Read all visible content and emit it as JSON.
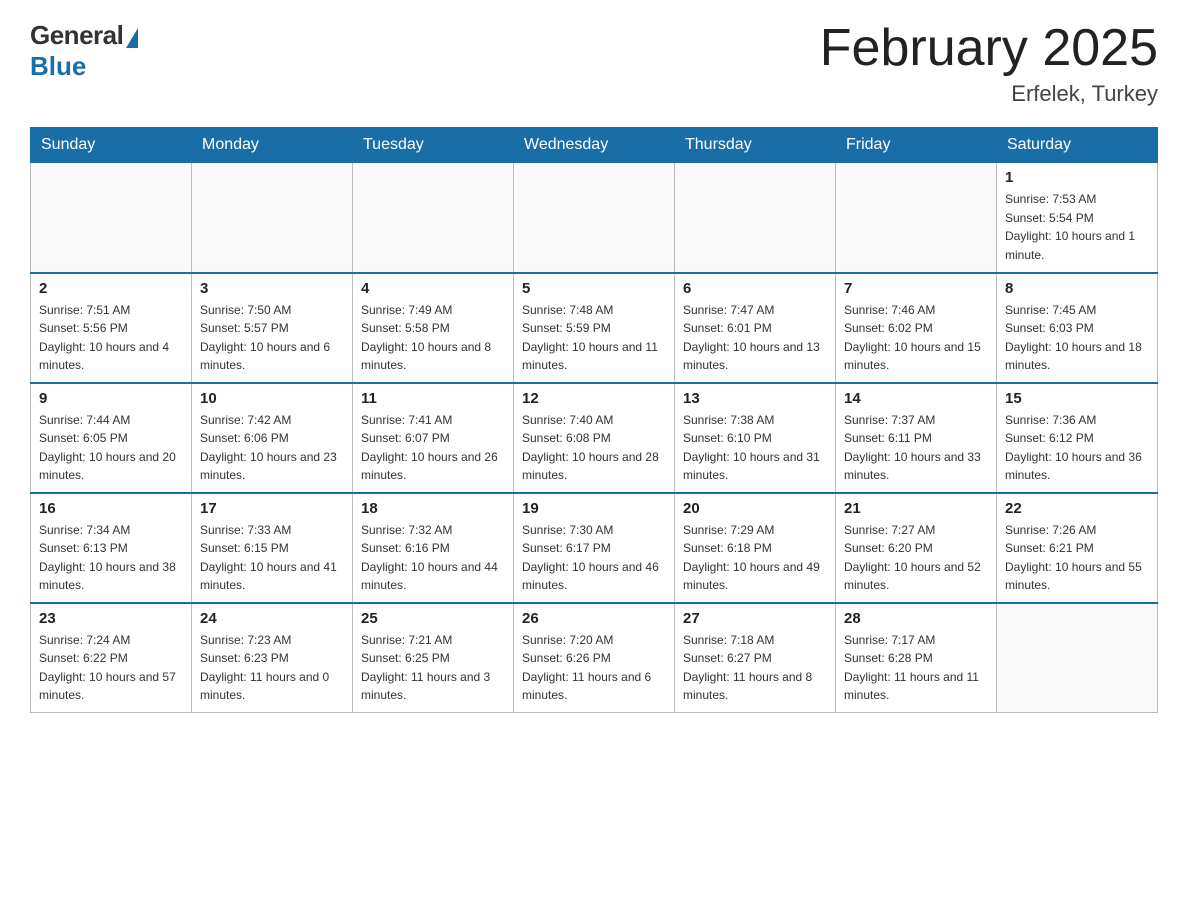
{
  "header": {
    "logo_general": "General",
    "logo_blue": "Blue",
    "month_title": "February 2025",
    "location": "Erfelek, Turkey"
  },
  "weekdays": [
    "Sunday",
    "Monday",
    "Tuesday",
    "Wednesday",
    "Thursday",
    "Friday",
    "Saturday"
  ],
  "weeks": [
    [
      {
        "day": "",
        "info": ""
      },
      {
        "day": "",
        "info": ""
      },
      {
        "day": "",
        "info": ""
      },
      {
        "day": "",
        "info": ""
      },
      {
        "day": "",
        "info": ""
      },
      {
        "day": "",
        "info": ""
      },
      {
        "day": "1",
        "info": "Sunrise: 7:53 AM\nSunset: 5:54 PM\nDaylight: 10 hours and 1 minute."
      }
    ],
    [
      {
        "day": "2",
        "info": "Sunrise: 7:51 AM\nSunset: 5:56 PM\nDaylight: 10 hours and 4 minutes."
      },
      {
        "day": "3",
        "info": "Sunrise: 7:50 AM\nSunset: 5:57 PM\nDaylight: 10 hours and 6 minutes."
      },
      {
        "day": "4",
        "info": "Sunrise: 7:49 AM\nSunset: 5:58 PM\nDaylight: 10 hours and 8 minutes."
      },
      {
        "day": "5",
        "info": "Sunrise: 7:48 AM\nSunset: 5:59 PM\nDaylight: 10 hours and 11 minutes."
      },
      {
        "day": "6",
        "info": "Sunrise: 7:47 AM\nSunset: 6:01 PM\nDaylight: 10 hours and 13 minutes."
      },
      {
        "day": "7",
        "info": "Sunrise: 7:46 AM\nSunset: 6:02 PM\nDaylight: 10 hours and 15 minutes."
      },
      {
        "day": "8",
        "info": "Sunrise: 7:45 AM\nSunset: 6:03 PM\nDaylight: 10 hours and 18 minutes."
      }
    ],
    [
      {
        "day": "9",
        "info": "Sunrise: 7:44 AM\nSunset: 6:05 PM\nDaylight: 10 hours and 20 minutes."
      },
      {
        "day": "10",
        "info": "Sunrise: 7:42 AM\nSunset: 6:06 PM\nDaylight: 10 hours and 23 minutes."
      },
      {
        "day": "11",
        "info": "Sunrise: 7:41 AM\nSunset: 6:07 PM\nDaylight: 10 hours and 26 minutes."
      },
      {
        "day": "12",
        "info": "Sunrise: 7:40 AM\nSunset: 6:08 PM\nDaylight: 10 hours and 28 minutes."
      },
      {
        "day": "13",
        "info": "Sunrise: 7:38 AM\nSunset: 6:10 PM\nDaylight: 10 hours and 31 minutes."
      },
      {
        "day": "14",
        "info": "Sunrise: 7:37 AM\nSunset: 6:11 PM\nDaylight: 10 hours and 33 minutes."
      },
      {
        "day": "15",
        "info": "Sunrise: 7:36 AM\nSunset: 6:12 PM\nDaylight: 10 hours and 36 minutes."
      }
    ],
    [
      {
        "day": "16",
        "info": "Sunrise: 7:34 AM\nSunset: 6:13 PM\nDaylight: 10 hours and 38 minutes."
      },
      {
        "day": "17",
        "info": "Sunrise: 7:33 AM\nSunset: 6:15 PM\nDaylight: 10 hours and 41 minutes."
      },
      {
        "day": "18",
        "info": "Sunrise: 7:32 AM\nSunset: 6:16 PM\nDaylight: 10 hours and 44 minutes."
      },
      {
        "day": "19",
        "info": "Sunrise: 7:30 AM\nSunset: 6:17 PM\nDaylight: 10 hours and 46 minutes."
      },
      {
        "day": "20",
        "info": "Sunrise: 7:29 AM\nSunset: 6:18 PM\nDaylight: 10 hours and 49 minutes."
      },
      {
        "day": "21",
        "info": "Sunrise: 7:27 AM\nSunset: 6:20 PM\nDaylight: 10 hours and 52 minutes."
      },
      {
        "day": "22",
        "info": "Sunrise: 7:26 AM\nSunset: 6:21 PM\nDaylight: 10 hours and 55 minutes."
      }
    ],
    [
      {
        "day": "23",
        "info": "Sunrise: 7:24 AM\nSunset: 6:22 PM\nDaylight: 10 hours and 57 minutes."
      },
      {
        "day": "24",
        "info": "Sunrise: 7:23 AM\nSunset: 6:23 PM\nDaylight: 11 hours and 0 minutes."
      },
      {
        "day": "25",
        "info": "Sunrise: 7:21 AM\nSunset: 6:25 PM\nDaylight: 11 hours and 3 minutes."
      },
      {
        "day": "26",
        "info": "Sunrise: 7:20 AM\nSunset: 6:26 PM\nDaylight: 11 hours and 6 minutes."
      },
      {
        "day": "27",
        "info": "Sunrise: 7:18 AM\nSunset: 6:27 PM\nDaylight: 11 hours and 8 minutes."
      },
      {
        "day": "28",
        "info": "Sunrise: 7:17 AM\nSunset: 6:28 PM\nDaylight: 11 hours and 11 minutes."
      },
      {
        "day": "",
        "info": ""
      }
    ]
  ]
}
